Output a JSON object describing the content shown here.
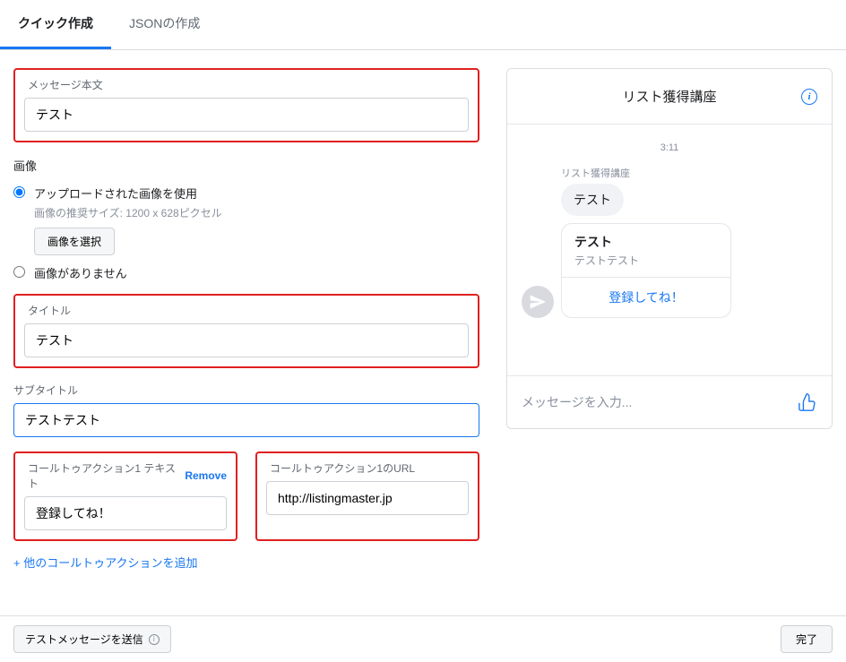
{
  "tabs": [
    {
      "label": "クイック作成",
      "active": true
    },
    {
      "label": "JSONの作成",
      "active": false
    }
  ],
  "form": {
    "messageBody": {
      "label": "メッセージ本文",
      "value": "テスト"
    },
    "imageSection": {
      "label": "画像",
      "options": {
        "uploaded": {
          "label": "アップロードされた画像を使用",
          "hint": "画像の推奨サイズ: 1200 x 628ピクセル",
          "buttonLabel": "画像を選択"
        },
        "none": {
          "label": "画像がありません"
        }
      }
    },
    "title": {
      "label": "タイトル",
      "value": "テスト"
    },
    "subtitle": {
      "label": "サブタイトル",
      "value": "テストテスト"
    },
    "cta1Text": {
      "label": "コールトゥアクション1 テキスト",
      "value": "登録してね！",
      "removeLabel": "Remove"
    },
    "cta1Url": {
      "label": "コールトゥアクション1のURL",
      "value": "http://listingmaster.jp"
    },
    "addCtaLabel": "+ 他のコールトゥアクションを追加"
  },
  "preview": {
    "headerTitle": "リスト獲得講座",
    "time": "3:11",
    "sender": "リスト獲得講座",
    "message": "テスト",
    "cardTitle": "テスト",
    "cardSubtitle": "テストテスト",
    "cardButton": "登録してね！",
    "inputPlaceholder": "メッセージを入力..."
  },
  "bottomBar": {
    "testLabel": "テストメッセージを送信",
    "doneLabel": "完了"
  }
}
